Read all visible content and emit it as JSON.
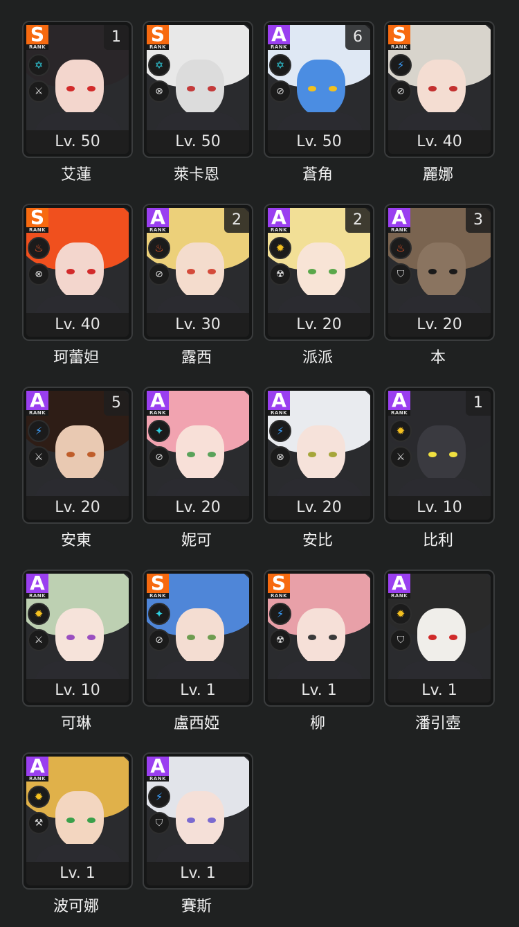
{
  "agents": [
    {
      "name": "艾蓮",
      "level": "Lv. 50",
      "rank": "S",
      "count": "1",
      "attribute": "ether",
      "attr_icon": "ice-icon",
      "role_icon": "attack-icon",
      "hair": "#2a2629",
      "skin": "#f3d6cd",
      "eye": "#d22a2a"
    },
    {
      "name": "萊卡恩",
      "level": "Lv. 50",
      "rank": "S",
      "count": "",
      "attribute": "ether",
      "attr_icon": "ice-icon",
      "role_icon": "stun-icon",
      "hair": "#e8e8e8",
      "skin": "#dcdcdc",
      "eye": "#c43a3a"
    },
    {
      "name": "蒼角",
      "level": "Lv. 50",
      "rank": "A",
      "count": "6",
      "attribute": "ether",
      "attr_icon": "ice-icon",
      "role_icon": "support-icon",
      "hair": "#dfe8f4",
      "skin": "#4b8de2",
      "eye": "#f0c020"
    },
    {
      "name": "麗娜",
      "level": "Lv. 40",
      "rank": "S",
      "count": "",
      "attribute": "electric",
      "attr_icon": "electric-icon",
      "role_icon": "support-icon",
      "hair": "#d8d4cc",
      "skin": "#f4ddd2",
      "eye": "#c3302f"
    },
    {
      "name": "珂蕾妲",
      "level": "Lv. 40",
      "rank": "S",
      "count": "",
      "attribute": "fire",
      "attr_icon": "fire-icon",
      "role_icon": "stun-icon",
      "hair": "#f0501e",
      "skin": "#f3d6cd",
      "eye": "#d22a2a"
    },
    {
      "name": "露西",
      "level": "Lv. 30",
      "rank": "A",
      "count": "2",
      "attribute": "fire",
      "attr_icon": "fire-icon",
      "role_icon": "support-icon",
      "hair": "#ecd07a",
      "skin": "#f4dccd",
      "eye": "#d44a3a"
    },
    {
      "name": "派派",
      "level": "Lv. 20",
      "rank": "A",
      "count": "2",
      "attribute": "physical",
      "attr_icon": "physical-icon",
      "role_icon": "anomaly-icon",
      "hair": "#f2df96",
      "skin": "#f8e4d6",
      "eye": "#5aa74a"
    },
    {
      "name": "本",
      "level": "Lv. 20",
      "rank": "A",
      "count": "3",
      "attribute": "fire",
      "attr_icon": "fire-icon",
      "role_icon": "defense-icon",
      "hair": "#7a6450",
      "skin": "#8a7460",
      "eye": "#1a1a1a"
    },
    {
      "name": "安東",
      "level": "Lv. 20",
      "rank": "A",
      "count": "5",
      "attribute": "electric",
      "attr_icon": "electric-icon",
      "role_icon": "attack-icon",
      "hair": "#2e1d16",
      "skin": "#e9c9b2",
      "eye": "#bf5d2a"
    },
    {
      "name": "妮可",
      "level": "Lv. 20",
      "rank": "A",
      "count": "",
      "attribute": "ether",
      "attr_icon": "ether-icon",
      "role_icon": "support-icon",
      "hair": "#f1a3b0",
      "skin": "#f8e0d8",
      "eye": "#5aa25a"
    },
    {
      "name": "安比",
      "level": "Lv. 20",
      "rank": "A",
      "count": "",
      "attribute": "electric",
      "attr_icon": "electric-icon",
      "role_icon": "stun-icon",
      "hair": "#e9ebef",
      "skin": "#f6e2da",
      "eye": "#a6a63a"
    },
    {
      "name": "比利",
      "level": "Lv. 10",
      "rank": "A",
      "count": "1",
      "attribute": "physical",
      "attr_icon": "physical-icon",
      "role_icon": "attack-icon",
      "hair": "#2a2a2e",
      "skin": "#3a3a40",
      "eye": "#f0e040"
    },
    {
      "name": "可琳",
      "level": "Lv. 10",
      "rank": "A",
      "count": "",
      "attribute": "physical",
      "attr_icon": "physical-icon",
      "role_icon": "attack-icon",
      "hair": "#bdd0b2",
      "skin": "#f6e3da",
      "eye": "#9a4fc0"
    },
    {
      "name": "盧西婭",
      "level": "Lv. 1",
      "rank": "S",
      "count": "",
      "attribute": "ether",
      "attr_icon": "ether-icon",
      "role_icon": "support-icon",
      "hair": "#4f86d8",
      "skin": "#f4ddd2",
      "eye": "#6e9c50"
    },
    {
      "name": "柳",
      "level": "Lv. 1",
      "rank": "S",
      "count": "",
      "attribute": "electric",
      "attr_icon": "electric-icon",
      "role_icon": "anomaly-icon",
      "hair": "#e8a0a8",
      "skin": "#f6e0d8",
      "eye": "#3a3a3a"
    },
    {
      "name": "潘引壺",
      "level": "Lv. 1",
      "rank": "A",
      "count": "",
      "attribute": "physical",
      "attr_icon": "physical-icon",
      "role_icon": "defense-icon",
      "hair": "#2a2a2a",
      "skin": "#f0eeea",
      "eye": "#d02a2a"
    },
    {
      "name": "波可娜",
      "level": "Lv. 1",
      "rank": "A",
      "count": "",
      "attribute": "physical",
      "attr_icon": "physical-icon",
      "role_icon": "rupture-icon",
      "hair": "#e0b14a",
      "skin": "#f3d6c0",
      "eye": "#3aa04a"
    },
    {
      "name": "賽斯",
      "level": "Lv. 1",
      "rank": "A",
      "count": "",
      "attribute": "electric",
      "attr_icon": "electric-icon",
      "role_icon": "defense-icon",
      "hair": "#e2e4ea",
      "skin": "#f5e0d8",
      "eye": "#7a6ad0"
    }
  ],
  "rank_sub": "RANK",
  "glyphs": {
    "ice-icon": "✡",
    "electric-icon": "⚡",
    "fire-icon": "♨",
    "physical-icon": "✹",
    "ether-icon": "✦",
    "attack-icon": "⚔",
    "stun-icon": "⊗",
    "support-icon": "⊘",
    "anomaly-icon": "☢",
    "defense-icon": "⛉",
    "rupture-icon": "⚒"
  }
}
